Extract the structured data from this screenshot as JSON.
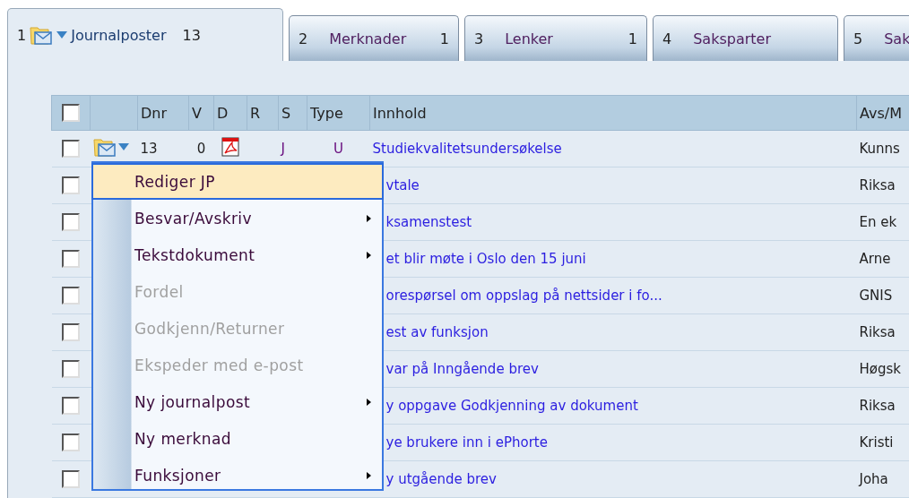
{
  "tabs": [
    {
      "number": "1",
      "label": "Journalposter",
      "count": "13",
      "selected": true,
      "icon": true
    },
    {
      "number": "2",
      "label": "Merknader",
      "count": "1",
      "selected": false
    },
    {
      "number": "3",
      "label": "Lenker",
      "count": "1",
      "selected": false
    },
    {
      "number": "4",
      "label": "Saksparter",
      "selected": false
    },
    {
      "number": "5",
      "label": "Sak",
      "selected": false
    }
  ],
  "table": {
    "header_checked": false,
    "columns": [
      "Dnr",
      "V",
      "D",
      "R",
      "S",
      "Type",
      "Innhold",
      "Avs/M"
    ],
    "rows": [
      {
        "checked": false,
        "icon": true,
        "dnr": "13",
        "v": "0",
        "pdf": true,
        "s": "J",
        "type": "U",
        "innhold": "Studiekvalitetsundersøkelse",
        "avs": "Kunns"
      },
      {
        "checked": false,
        "innhold": "vtale",
        "avs": "Riksa"
      },
      {
        "checked": false,
        "innhold": "ksamenstest",
        "avs": "En ek"
      },
      {
        "checked": false,
        "innhold": "et blir møte i Oslo den 15 juni",
        "avs": "Arne"
      },
      {
        "checked": false,
        "innhold": "orespørsel om oppslag på nettsider i fo...",
        "avs": "GNIS"
      },
      {
        "checked": false,
        "innhold": "est av funksjon",
        "avs": "Riksa"
      },
      {
        "checked": false,
        "innhold": "var på Inngående brev",
        "avs": "Høgsk"
      },
      {
        "checked": false,
        "innhold": "y oppgave Godkjenning av dokument",
        "avs": "Riksa"
      },
      {
        "checked": false,
        "innhold": "ye brukere inn i ePhorte",
        "avs": "Kristi"
      },
      {
        "checked": false,
        "innhold": "y utgående brev",
        "avs": "Joha"
      }
    ]
  },
  "context_menu": {
    "items": [
      {
        "label": "Rediger JP",
        "selected": true,
        "disabled": false,
        "submenu": false
      },
      {
        "label": "Besvar/Avskriv",
        "selected": false,
        "disabled": false,
        "submenu": true
      },
      {
        "label": "Tekstdokument",
        "selected": false,
        "disabled": false,
        "submenu": true
      },
      {
        "label": "Fordel",
        "selected": false,
        "disabled": true,
        "submenu": false
      },
      {
        "label": "Godkjenn/Returner",
        "selected": false,
        "disabled": true,
        "submenu": false
      },
      {
        "label": "Ekspeder med e-post",
        "selected": false,
        "disabled": true,
        "submenu": false
      },
      {
        "label": "Ny journalpost",
        "selected": false,
        "disabled": false,
        "submenu": true
      },
      {
        "label": "Ny merknad",
        "selected": false,
        "disabled": false,
        "submenu": false
      },
      {
        "label": "Funksjoner",
        "selected": false,
        "disabled": false,
        "submenu": true
      }
    ]
  }
}
